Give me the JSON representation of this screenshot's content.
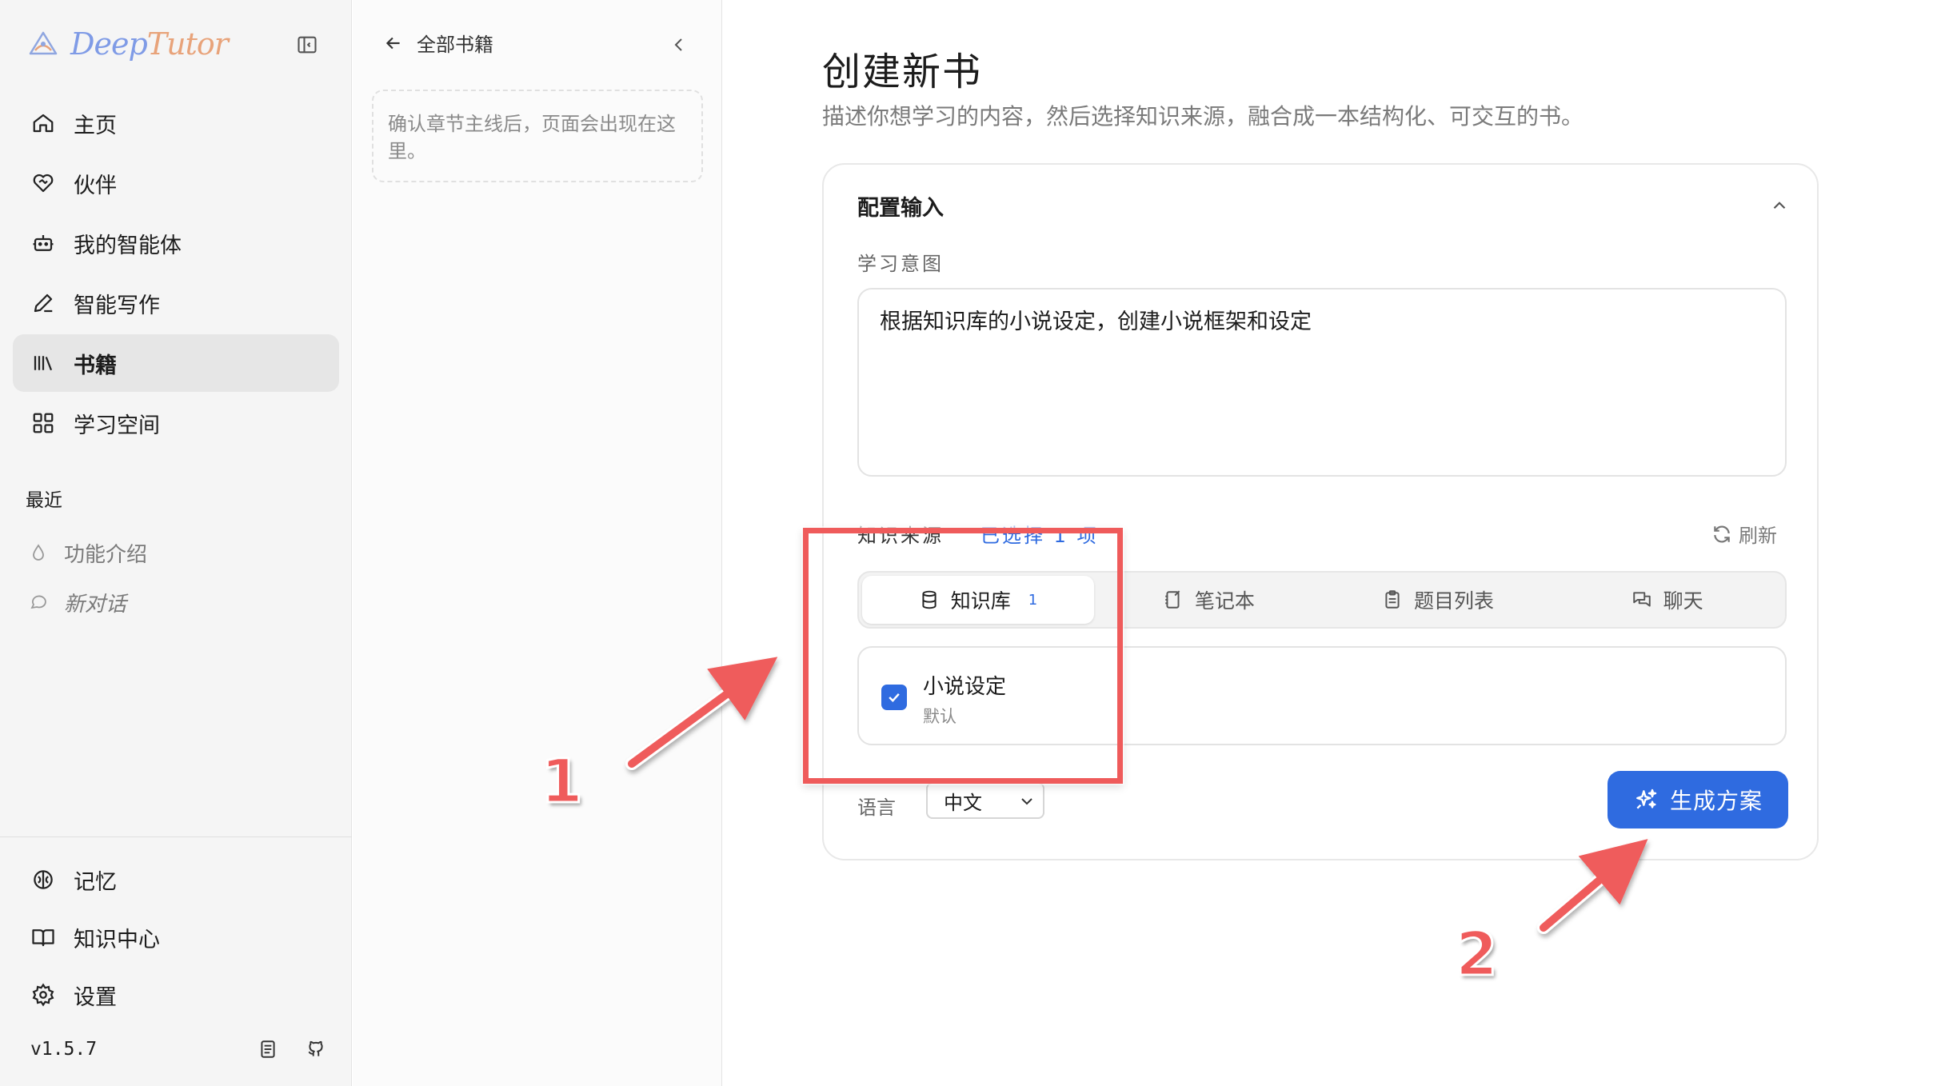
{
  "brand": {
    "name_part1": "Deep",
    "name_part2": "Tutor"
  },
  "sidebar": {
    "nav": [
      {
        "label": "主页",
        "icon": "home-icon"
      },
      {
        "label": "伙伴",
        "icon": "heart-handshake-icon"
      },
      {
        "label": "我的智能体",
        "icon": "bot-icon"
      },
      {
        "label": "智能写作",
        "icon": "pen-icon"
      },
      {
        "label": "书籍",
        "icon": "library-icon",
        "active": true
      },
      {
        "label": "学习空间",
        "icon": "grid-icon"
      }
    ],
    "recent_title": "最近",
    "recent": [
      {
        "label": "功能介绍",
        "icon": "drop-icon"
      },
      {
        "label": "新对话",
        "icon": "chat-icon"
      }
    ],
    "bottom_nav": [
      {
        "label": "记忆",
        "icon": "brain-icon"
      },
      {
        "label": "知识中心",
        "icon": "book-open-icon"
      },
      {
        "label": "设置",
        "icon": "gear-icon"
      }
    ],
    "version": "v1.5.7"
  },
  "middle": {
    "back_label": "全部书籍",
    "hint": "确认章节主线后，页面会出现在这里。"
  },
  "main": {
    "title": "创建新书",
    "description": "描述你想学习的内容，然后选择知识来源，融合成一本结构化、可交互的书。",
    "card_title": "配置输入",
    "intent_label": "学习意图",
    "intent_value": "根据知识库的小说设定，创建小说框架和设定",
    "source_label": "知识来源",
    "source_selected": "已选择 1 项",
    "refresh_label": "刷新",
    "tabs": [
      {
        "label": "知识库",
        "count": "1",
        "icon": "database-icon"
      },
      {
        "label": "笔记本",
        "icon": "notebook-icon"
      },
      {
        "label": "题目列表",
        "icon": "clipboard-icon"
      },
      {
        "label": "聊天",
        "icon": "chat-icon"
      }
    ],
    "kb_item": {
      "name": "小说设定",
      "sub": "默认",
      "checked": true
    },
    "language_label": "语言",
    "language_value": "中文",
    "generate_label": "生成方案"
  },
  "annotations": {
    "num1": "1",
    "num2": "2",
    "color": "#ef5b5b"
  },
  "colors": {
    "accent": "#2f6be0",
    "annotation": "#ef5b5b"
  }
}
